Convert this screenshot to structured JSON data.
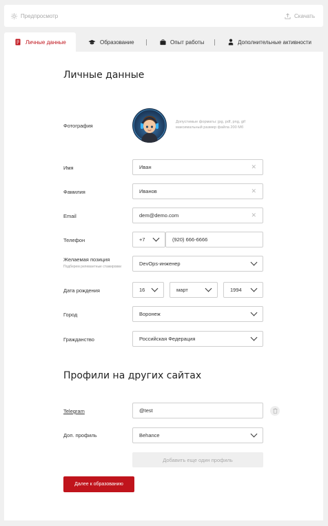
{
  "topbar": {
    "preview_label": "Предпросмотр",
    "download_label": "Скачать"
  },
  "tabs": [
    {
      "label": "Личные данные",
      "icon": "document-icon",
      "active": true
    },
    {
      "label": "Образование",
      "icon": "graduation-cap-icon",
      "active": false
    },
    {
      "label": "Опыт работы",
      "icon": "briefcase-icon",
      "active": false
    },
    {
      "label": "Дополнительные активности",
      "icon": "person-badge-icon",
      "active": false
    }
  ],
  "personal": {
    "title": "Личные данные",
    "photo_label": "Фотография",
    "photo_hint": "Допустимые форматы: jpg, pdf, png, gif максимальный размер файла 200 Мб",
    "first_name_label": "Имя",
    "first_name_value": "Иван",
    "last_name_label": "Фамилия",
    "last_name_value": "Иванов",
    "email_label": "Email",
    "email_value": "dem@demo.com",
    "phone_label": "Телефон",
    "phone_code": "+7",
    "phone_value": "(920) 666-6666",
    "position_label": "Желаемая позиция",
    "position_hint": "Подберем релевантные стажировки",
    "position_value": "DevOps-инженер",
    "birth_label": "Дата рождения",
    "birth_day": "16",
    "birth_month": "март",
    "birth_year": "1994",
    "city_label": "Город",
    "city_value": "Воронеж",
    "citizenship_label": "Гражданство",
    "citizenship_value": "Российская Федерация"
  },
  "profiles": {
    "title": "Профили на других сайтах",
    "telegram_label": "Telegram",
    "telegram_value": "@test",
    "extra_label": "Доп. профиль",
    "extra_value": "Behance",
    "add_button": "Добавить еще один профиль"
  },
  "next_button": "Далее к образованию",
  "colors": {
    "accent": "#c0141c",
    "page_bg": "#f0f0f0",
    "border": "#cfcfcf"
  }
}
